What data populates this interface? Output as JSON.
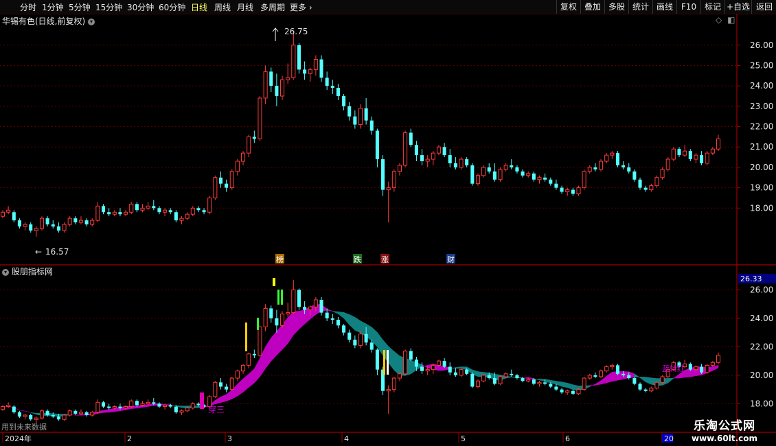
{
  "toolbar": {
    "periods": [
      "分时",
      "1分钟",
      "5分钟",
      "15分钟",
      "30分钟",
      "60分钟",
      "日线",
      "周线",
      "月线",
      "多周期",
      "更多 ›"
    ],
    "active_period": "日线",
    "right_buttons": [
      "复权",
      "叠加",
      "多股",
      "统计",
      "画线",
      "F10",
      "标记",
      "+自选",
      "返回"
    ]
  },
  "main_panel": {
    "title": "华锡有色(日线,前复权)",
    "high_label": "26.75",
    "low_label": "16.57",
    "event_tags": [
      "榜",
      "跌",
      "涨",
      "财"
    ],
    "y_ticks": [
      "26.00",
      "25.00",
      "24.00",
      "23.00",
      "22.00",
      "21.00",
      "20.00",
      "19.00",
      "18.00"
    ]
  },
  "indicator_panel": {
    "title": "股朋指标网",
    "value_box": "26.33",
    "y_ticks": [
      "26.00",
      "24.00",
      "22.00",
      "20.00",
      "18.00"
    ],
    "signal_label": "穿三",
    "signal_label_2": "蓝转红"
  },
  "x_axis": {
    "labels": [
      "2024年",
      "2",
      "3",
      "4",
      "5",
      "6",
      "20"
    ]
  },
  "hint": "用到未来数据",
  "watermark": {
    "title": "乐淘公式网",
    "url": "www.60lt.com"
  },
  "colors": {
    "up": "#ff3b3b",
    "down": "#54ffff",
    "band_up": "#c000c0",
    "band_down": "#108080",
    "grid": "#5a0000",
    "axis": "#a00000"
  },
  "chart_data": {
    "type": "candlestick",
    "series": [
      {
        "name": "华锡有色",
        "ohlc": [
          [
            17.6,
            17.9,
            17.5,
            17.8
          ],
          [
            17.8,
            18.1,
            17.7,
            17.9
          ],
          [
            17.8,
            17.9,
            17.3,
            17.4
          ],
          [
            17.4,
            17.5,
            17.0,
            17.1
          ],
          [
            17.1,
            17.3,
            16.9,
            17.2
          ],
          [
            17.2,
            17.3,
            16.8,
            16.9
          ],
          [
            16.9,
            17.1,
            16.6,
            17.0
          ],
          [
            17.0,
            17.6,
            16.9,
            17.5
          ],
          [
            17.5,
            17.6,
            17.1,
            17.2
          ],
          [
            17.2,
            17.4,
            17.0,
            17.1
          ],
          [
            17.1,
            17.3,
            16.8,
            16.9
          ],
          [
            16.9,
            17.3,
            16.8,
            17.2
          ],
          [
            17.2,
            17.6,
            17.1,
            17.5
          ],
          [
            17.5,
            17.6,
            17.2,
            17.3
          ],
          [
            17.3,
            17.6,
            17.2,
            17.4
          ],
          [
            17.4,
            17.5,
            17.1,
            17.2
          ],
          [
            17.2,
            17.5,
            17.1,
            17.4
          ],
          [
            17.4,
            18.3,
            17.3,
            18.1
          ],
          [
            18.1,
            18.2,
            17.7,
            17.8
          ],
          [
            17.8,
            18.0,
            17.6,
            17.7
          ],
          [
            17.7,
            17.9,
            17.6,
            17.8
          ],
          [
            17.8,
            18.0,
            17.6,
            17.7
          ],
          [
            17.7,
            17.9,
            17.6,
            17.8
          ],
          [
            17.8,
            18.3,
            17.7,
            18.2
          ],
          [
            18.2,
            18.3,
            17.8,
            17.9
          ],
          [
            17.9,
            18.2,
            17.8,
            18.0
          ],
          [
            18.0,
            18.3,
            17.9,
            18.1
          ],
          [
            18.1,
            18.4,
            17.9,
            18.0
          ],
          [
            18.0,
            18.1,
            17.7,
            17.8
          ],
          [
            17.8,
            18.0,
            17.6,
            17.9
          ],
          [
            17.9,
            18.0,
            17.7,
            17.8
          ],
          [
            17.8,
            17.9,
            17.3,
            17.4
          ],
          [
            17.4,
            17.6,
            17.2,
            17.5
          ],
          [
            17.5,
            17.8,
            17.4,
            17.7
          ],
          [
            17.7,
            18.1,
            17.6,
            18.0
          ],
          [
            18.0,
            18.1,
            17.8,
            17.9
          ],
          [
            17.9,
            18.0,
            17.7,
            17.8
          ],
          [
            17.8,
            18.6,
            17.7,
            18.5
          ],
          [
            18.5,
            19.6,
            18.4,
            19.5
          ],
          [
            19.5,
            19.8,
            19.0,
            19.2
          ],
          [
            19.2,
            19.4,
            18.8,
            19.0
          ],
          [
            19.0,
            19.9,
            18.9,
            19.8
          ],
          [
            19.8,
            20.4,
            19.6,
            20.3
          ],
          [
            20.3,
            20.8,
            20.1,
            20.7
          ],
          [
            20.7,
            21.6,
            20.5,
            21.5
          ],
          [
            21.5,
            21.8,
            21.2,
            21.4
          ],
          [
            21.4,
            23.5,
            21.3,
            23.4
          ],
          [
            23.4,
            25.0,
            23.1,
            24.7
          ],
          [
            24.7,
            24.9,
            23.7,
            24.0
          ],
          [
            24.0,
            24.6,
            23.0,
            23.5
          ],
          [
            23.5,
            24.5,
            23.3,
            24.3
          ],
          [
            24.3,
            25.1,
            24.1,
            24.4
          ],
          [
            24.4,
            26.7,
            24.3,
            26.0
          ],
          [
            26.0,
            26.1,
            24.6,
            24.8
          ],
          [
            24.8,
            25.2,
            24.3,
            24.6
          ],
          [
            24.6,
            24.9,
            24.2,
            24.8
          ],
          [
            24.8,
            25.5,
            24.5,
            25.3
          ],
          [
            25.3,
            25.5,
            24.2,
            24.4
          ],
          [
            24.4,
            24.7,
            23.8,
            24.0
          ],
          [
            24.0,
            24.3,
            23.6,
            23.9
          ],
          [
            23.9,
            24.1,
            23.3,
            23.5
          ],
          [
            23.5,
            23.6,
            22.8,
            23.0
          ],
          [
            23.0,
            23.2,
            22.3,
            22.5
          ],
          [
            22.5,
            22.8,
            21.9,
            22.1
          ],
          [
            22.1,
            23.1,
            21.9,
            22.9
          ],
          [
            22.9,
            23.4,
            22.1,
            22.3
          ],
          [
            22.3,
            22.5,
            21.6,
            21.8
          ],
          [
            21.8,
            21.9,
            20.0,
            20.4
          ],
          [
            20.4,
            20.6,
            18.6,
            18.9
          ],
          [
            18.9,
            19.3,
            17.3,
            19.0
          ],
          [
            19.0,
            19.9,
            18.8,
            19.8
          ],
          [
            19.8,
            20.2,
            19.6,
            20.1
          ],
          [
            20.1,
            21.8,
            20.0,
            21.7
          ],
          [
            21.7,
            21.9,
            21.0,
            21.1
          ],
          [
            21.1,
            21.3,
            20.3,
            20.6
          ],
          [
            20.6,
            20.9,
            20.1,
            20.3
          ],
          [
            20.3,
            20.6,
            20.0,
            20.4
          ],
          [
            20.4,
            20.8,
            20.1,
            20.7
          ],
          [
            20.7,
            21.1,
            20.6,
            21.0
          ],
          [
            21.0,
            21.2,
            20.5,
            20.6
          ],
          [
            20.6,
            20.9,
            20.0,
            20.2
          ],
          [
            20.2,
            20.5,
            19.9,
            20.0
          ],
          [
            20.0,
            20.5,
            19.9,
            20.4
          ],
          [
            20.4,
            20.5,
            20.0,
            20.1
          ],
          [
            20.1,
            20.2,
            19.1,
            19.2
          ],
          [
            19.2,
            19.7,
            19.1,
            19.6
          ],
          [
            19.6,
            20.1,
            19.5,
            20.0
          ],
          [
            20.0,
            20.2,
            19.7,
            19.8
          ],
          [
            19.8,
            20.2,
            19.3,
            19.4
          ],
          [
            19.4,
            20.0,
            19.3,
            19.9
          ],
          [
            19.9,
            20.2,
            19.8,
            20.1
          ],
          [
            20.1,
            20.4,
            19.9,
            20.0
          ],
          [
            20.0,
            20.1,
            19.7,
            19.8
          ],
          [
            19.8,
            19.9,
            19.5,
            19.6
          ],
          [
            19.6,
            19.8,
            19.5,
            19.7
          ],
          [
            19.7,
            19.8,
            19.3,
            19.4
          ],
          [
            19.4,
            19.6,
            19.2,
            19.5
          ],
          [
            19.5,
            19.7,
            19.3,
            19.4
          ],
          [
            19.4,
            19.5,
            19.1,
            19.2
          ],
          [
            19.2,
            19.4,
            18.9,
            19.0
          ],
          [
            19.0,
            19.1,
            18.7,
            18.8
          ],
          [
            18.8,
            19.0,
            18.6,
            18.9
          ],
          [
            18.9,
            19.0,
            18.6,
            18.7
          ],
          [
            18.7,
            19.1,
            18.6,
            19.0
          ],
          [
            19.0,
            19.9,
            18.9,
            19.8
          ],
          [
            19.8,
            20.1,
            19.7,
            20.0
          ],
          [
            20.0,
            20.2,
            19.8,
            19.9
          ],
          [
            19.9,
            20.4,
            19.8,
            20.3
          ],
          [
            20.3,
            20.7,
            20.2,
            20.6
          ],
          [
            20.6,
            20.8,
            20.4,
            20.7
          ],
          [
            20.7,
            20.8,
            20.0,
            20.1
          ],
          [
            20.1,
            20.3,
            19.9,
            20.0
          ],
          [
            20.0,
            20.2,
            19.7,
            19.8
          ],
          [
            19.8,
            19.9,
            19.3,
            19.4
          ],
          [
            19.4,
            19.5,
            18.9,
            19.0
          ],
          [
            19.0,
            19.1,
            18.8,
            18.9
          ],
          [
            18.9,
            19.2,
            18.8,
            19.1
          ],
          [
            19.1,
            19.6,
            19.0,
            19.5
          ],
          [
            19.5,
            20.0,
            19.4,
            19.9
          ],
          [
            19.9,
            20.5,
            19.8,
            20.4
          ],
          [
            20.4,
            21.0,
            20.3,
            20.9
          ],
          [
            20.9,
            21.0,
            20.5,
            20.6
          ],
          [
            20.6,
            21.1,
            20.5,
            20.8
          ],
          [
            20.8,
            20.9,
            20.3,
            20.4
          ],
          [
            20.4,
            20.7,
            20.2,
            20.6
          ],
          [
            20.6,
            20.8,
            20.1,
            20.2
          ],
          [
            20.2,
            20.8,
            20.1,
            20.7
          ],
          [
            20.7,
            21.0,
            20.6,
            20.9
          ],
          [
            20.9,
            21.6,
            20.8,
            21.4
          ]
        ]
      }
    ],
    "y_range_main": [
      17.0,
      26.8
    ],
    "y_range_indicator": [
      17.2,
      26.6
    ],
    "x_labels": [
      "2024年",
      "2",
      "3",
      "4",
      "5",
      "6",
      "20"
    ]
  }
}
